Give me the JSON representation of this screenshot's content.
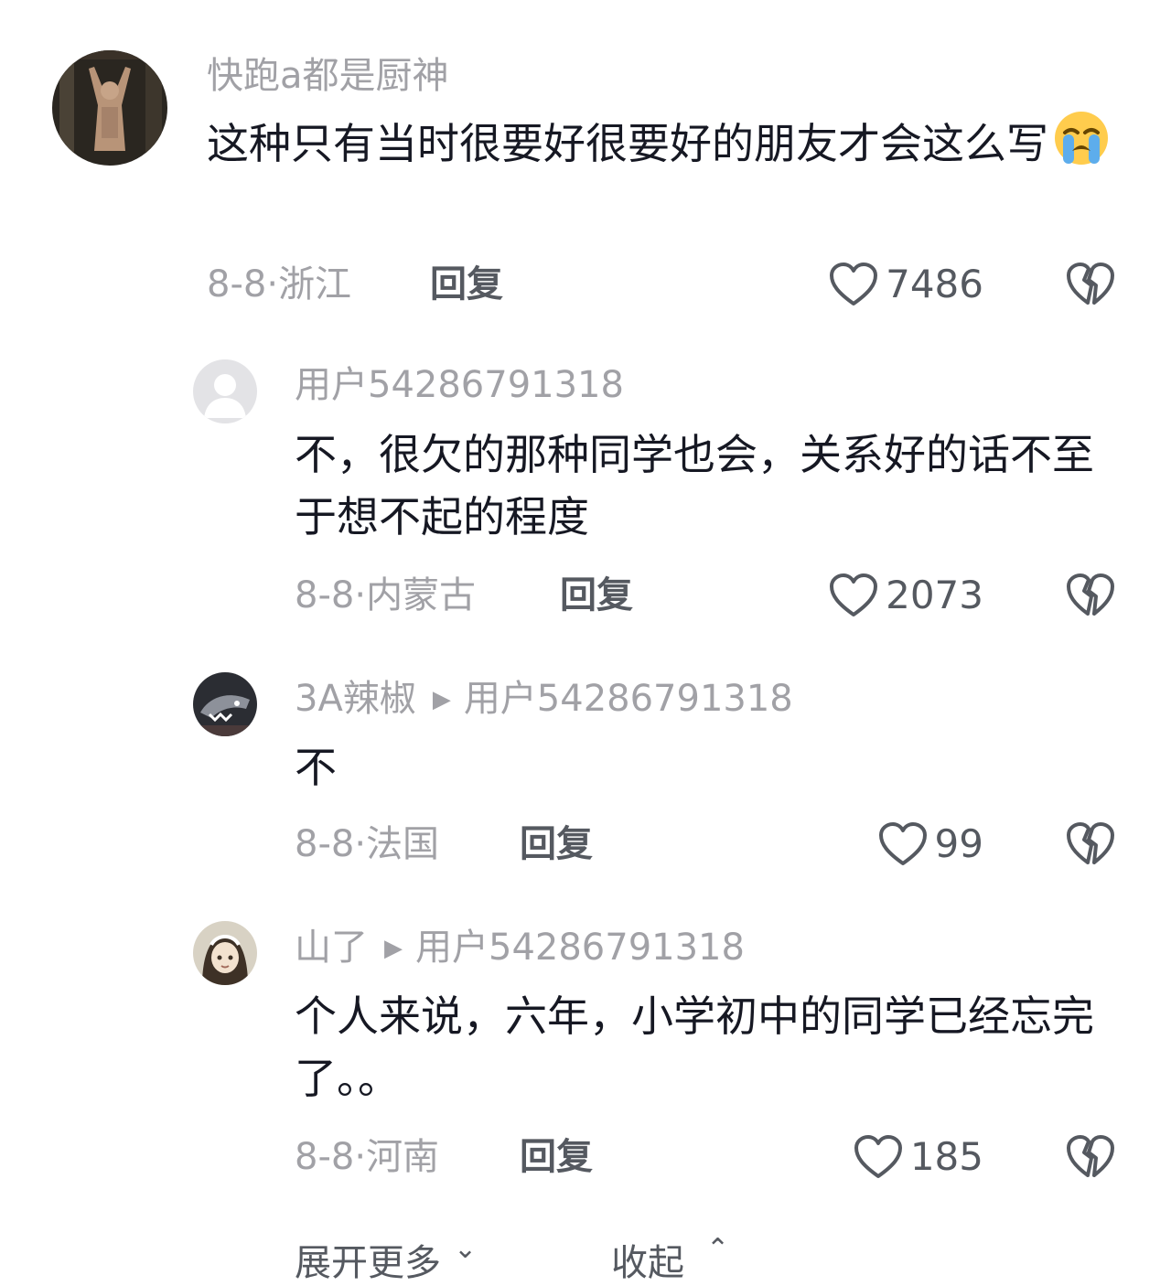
{
  "comments": [
    {
      "username": "快跑a都是厨神",
      "content": "这种只有当时很要好很要好的朋友才会这么写",
      "date": "8-8",
      "separator": "·",
      "location": "浙江",
      "reply_label": "回复",
      "likes": "7486",
      "emoji": "loudly-crying-face"
    },
    {
      "username": "用户54286791318",
      "content": "不，很欠的那种同学也会，关系好的话不至于想不起的程度",
      "date": "8-8",
      "separator": "·",
      "location": "内蒙古",
      "reply_label": "回复",
      "likes": "2073"
    },
    {
      "username": "3A辣椒",
      "reply_to": "用户54286791318",
      "content": "不",
      "date": "8-8",
      "separator": "·",
      "location": "法国",
      "reply_label": "回复",
      "likes": "99"
    },
    {
      "username": "山了",
      "reply_to": "用户54286791318",
      "content": "个人来说，六年，小学初中的同学已经忘完了。。",
      "date": "8-8",
      "separator": "·",
      "location": "河南",
      "reply_label": "回复",
      "likes": "185"
    }
  ],
  "footer": {
    "expand_more": "展开更多",
    "collapse": "收起"
  },
  "icons": {
    "like": "heart-outline-icon",
    "dislike": "broken-heart-icon",
    "reply_arrow": "play-triangle-icon"
  },
  "colors": {
    "text_primary": "#161823",
    "text_secondary": "#a1a1a6",
    "action_text": "#555960"
  }
}
